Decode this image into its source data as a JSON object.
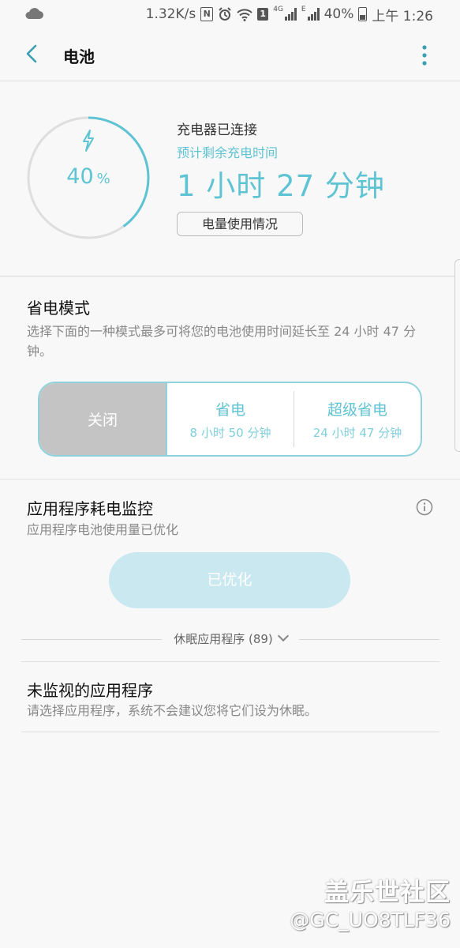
{
  "status_bar": {
    "speed": "1.32K/s",
    "nfc_glyph": "N",
    "sim_glyph": "1",
    "net1": "4G",
    "net2": "E",
    "battery": "40%",
    "time": "上午 1:26"
  },
  "app_bar": {
    "title": "电池"
  },
  "battery": {
    "percent_number": "40",
    "percent_unit": "%",
    "level": 0.4,
    "charger_status": "充电器已连接",
    "estimate_label": "预计剩余充电时间",
    "estimate_value": "1 小时 27 分钟",
    "usage_button": "电量使用情况",
    "accent_color": "#5ec3d2"
  },
  "power_mode": {
    "title": "省电模式",
    "description": "选择下面的一种模式最多可将您的电池使用时间延长至 24 小时 47 分钟。",
    "options": [
      {
        "name": "关闭",
        "selected": true
      },
      {
        "name": "省电",
        "time": "8 小时 50 分钟"
      },
      {
        "name": "超级省电",
        "time": "24 小时 47 分钟"
      }
    ]
  },
  "app_monitor": {
    "title": "应用程序耗电监控",
    "description": "应用程序电池使用量已优化",
    "button": "已优化",
    "sleeping_apps": "休眠应用程序 (89)"
  },
  "unmonitored": {
    "title": "未监视的应用程序",
    "description": "请选择应用程序，系统不会建议您将它们设为休眠。"
  },
  "watermark": {
    "line1": "盖乐世社区",
    "line2": "@GC_UO8TLF36"
  }
}
